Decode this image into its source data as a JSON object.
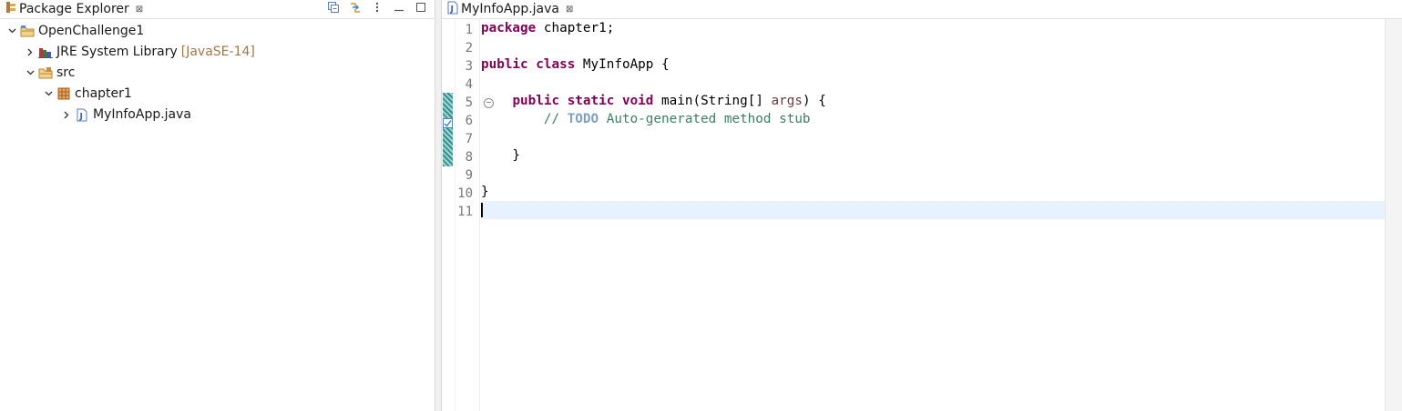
{
  "explorer": {
    "title": "Package Explorer",
    "tree": [
      {
        "label": "OpenChallenge1",
        "decoration": "",
        "icon": "java-project-icon",
        "expanded": true,
        "level": 0
      },
      {
        "label": "JRE System Library",
        "decoration": "[JavaSE-14]",
        "icon": "library-icon",
        "expanded": false,
        "level": 1
      },
      {
        "label": "src",
        "decoration": "",
        "icon": "source-folder-icon",
        "expanded": true,
        "level": 1
      },
      {
        "label": "chapter1",
        "decoration": "",
        "icon": "package-icon",
        "expanded": true,
        "level": 2
      },
      {
        "label": "MyInfoApp.java",
        "decoration": "",
        "icon": "java-file-icon",
        "expanded": false,
        "level": 3
      }
    ]
  },
  "editor": {
    "tab_title": "MyInfoApp.java",
    "line_numbers": [
      "1",
      "2",
      "3",
      "4",
      "5",
      "6",
      "7",
      "8",
      "9",
      "10",
      "11"
    ],
    "lines": [
      {
        "text": "package chapter1;"
      },
      {
        "text": ""
      },
      {
        "text": "public class MyInfoApp {"
      },
      {
        "text": ""
      },
      {
        "text": "    public static void main(String[] args) {"
      },
      {
        "text": "        // TODO Auto-generated method stub"
      },
      {
        "text": ""
      },
      {
        "text": "    }"
      },
      {
        "text": ""
      },
      {
        "text": "}"
      },
      {
        "text": ""
      }
    ],
    "current_line": 11
  },
  "colors": {
    "keyword": "#7f0055",
    "comment": "#3f7f5f",
    "todo": "#7f9fbf",
    "current_line": "#e8f2fe",
    "decoration": "#a0774a"
  }
}
